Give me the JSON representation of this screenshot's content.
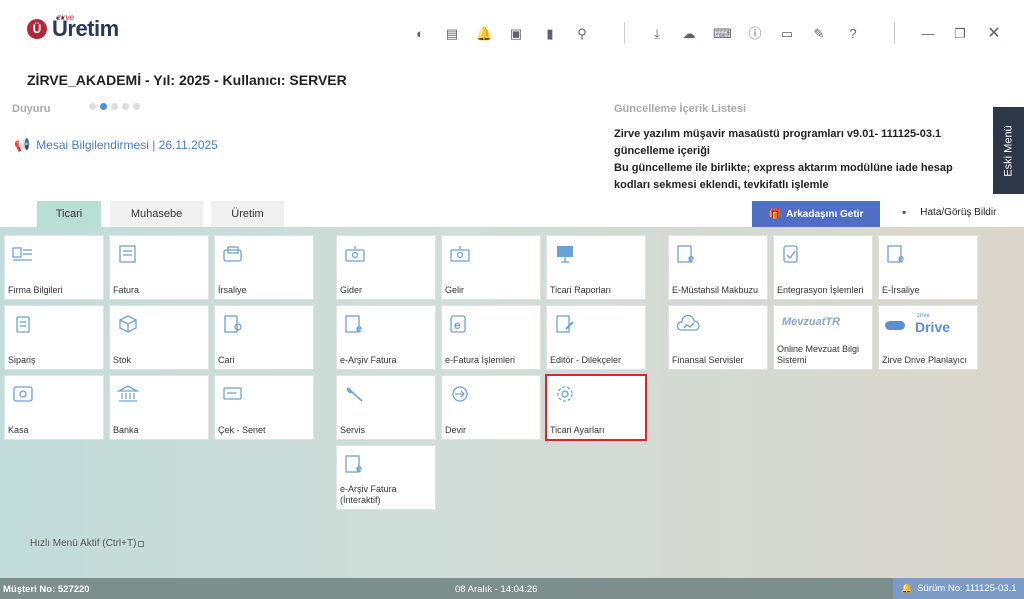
{
  "app": {
    "logo_small": "zirve",
    "logo_text": "Üretim",
    "logo_mark": "Ü"
  },
  "header": {
    "company_line": "ZİRVE_AKADEMİ - Yıl: 2025 - Kullanıcı: SERVER"
  },
  "toolbar_icons": [
    "moon-icon",
    "calculator-icon",
    "bell-icon",
    "money-icon",
    "book-icon",
    "location-icon",
    "download-icon",
    "cloud-upload-icon",
    "keyboard-icon",
    "info-icon",
    "chat-icon",
    "edit-icon",
    "help-icon",
    "minimize-icon",
    "restore-icon",
    "close-icon"
  ],
  "announcement": {
    "label": "Duyuru",
    "active_dot": 1,
    "dot_count": 5,
    "message": "Mesai Bilgilendirmesi | 26.11.2025"
  },
  "update": {
    "title": "Güncelleme İçerik Listesi",
    "lines": [
      "Zirve yazılım müşavir masaüstü programları v9.01- 111125-03.1 güncelleme içeriği",
      "Bu güncelleme ile birlikte; express aktarım modülüne iade hesap kodları sekmesi eklendi, tevkifatlı işlemle"
    ]
  },
  "side_button": "Eski Menü",
  "tabs": [
    {
      "label": "Ticari",
      "active": true
    },
    {
      "label": "Muhasebe",
      "active": false
    },
    {
      "label": "Üretim",
      "active": false
    }
  ],
  "actions": {
    "invite": "Arkadaşını Getir",
    "feedback": "Hata/Görüş Bildir"
  },
  "tiles": {
    "group1": [
      "Firma Bilgileri",
      "Fatura",
      "İrsaliye",
      "Sipariş",
      "Stok",
      "Cari",
      "Kasa",
      "Banka",
      "Çek - Senet"
    ],
    "group2": [
      "Gider",
      "Gelir",
      "Ticari Raporları",
      "e-Arşiv Fatura",
      "e-Fatura İşlemleri",
      "Editör - Dilekçeler",
      "Servis",
      "Devir",
      "Ticari Ayarları",
      "e-Arşiv Fatura (İnteraktif)"
    ],
    "group3": [
      "E-Müstahsil Makbuzu",
      "Entegrasyon İşlemleri",
      "E-İrsaliye",
      "Finansal Servisler",
      "Online Mevzuat Bilgi Sistemi",
      "Zirve Drive Planlayıcı"
    ],
    "group3_logos": {
      "mevzuat": "MevzuatTR",
      "drive_small": "zirve",
      "drive": "Drive"
    },
    "selected": "Ticari Ayarları"
  },
  "quick_menu": "Hızlı Menü Aktif (Ctrl+T)",
  "status": {
    "customer": "Müşteri No: 527220",
    "datetime": "08 Aralık - 14:04:26",
    "version": "Sürüm No: 111125-03.1"
  },
  "colors": {
    "accent": "#4e6fc4",
    "brand": "#b0283c",
    "tab_active": "#b9ded4",
    "selection": "#e0242e",
    "statusbar": "#7c8f8d"
  }
}
